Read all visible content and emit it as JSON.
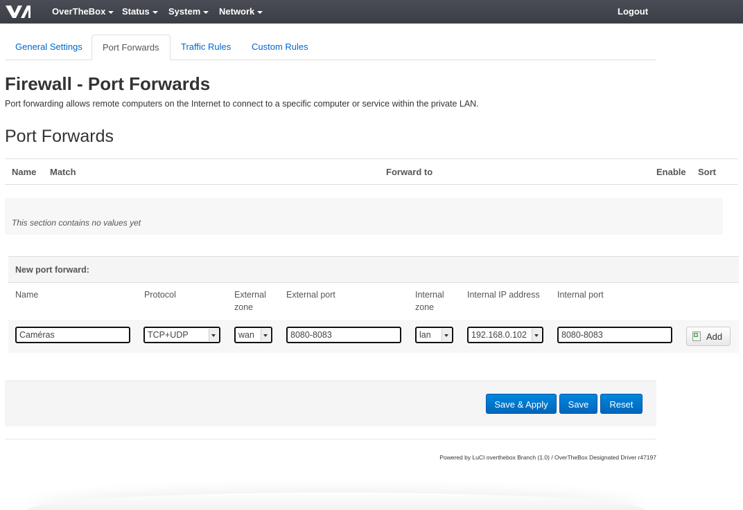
{
  "nav": {
    "brand": "OverTheBox",
    "status": "Status",
    "system": "System",
    "network": "Network",
    "logout": "Logout"
  },
  "tabs": [
    {
      "label": "General Settings",
      "active": false
    },
    {
      "label": "Port Forwards",
      "active": true
    },
    {
      "label": "Traffic Rules",
      "active": false
    },
    {
      "label": "Custom Rules",
      "active": false
    }
  ],
  "page": {
    "title": "Firewall - Port Forwards",
    "description": "Port forwarding allows remote computers on the Internet to connect to a specific computer or service within the private LAN."
  },
  "section": {
    "title": "Port Forwards",
    "headers": {
      "name": "Name",
      "match": "Match",
      "forward_to": "Forward to",
      "enable": "Enable",
      "sort": "Sort"
    },
    "empty_text": "This section contains no values yet"
  },
  "new_forward": {
    "heading": "New port forward:",
    "labels": {
      "name": "Name",
      "protocol": "Protocol",
      "external_zone": [
        "External",
        "zone"
      ],
      "external_port": "External port",
      "internal_zone": [
        "Internal",
        "zone"
      ],
      "internal_ip": "Internal IP address",
      "internal_port": "Internal port"
    },
    "values": {
      "name": "Caméras",
      "protocol": "TCP+UDP",
      "external_zone": "wan",
      "external_port": "8080-8083",
      "internal_zone": "lan",
      "internal_ip": "192.168.0.102",
      "internal_port": "8080-8083"
    },
    "add_label": "Add"
  },
  "actions": {
    "save_apply": "Save & Apply",
    "save": "Save",
    "reset": "Reset"
  },
  "footer": "Powered by LuCI overthebox Branch (1.0) / OverTheBox Designated Driver r47197",
  "colors": {
    "navbar": "#3f4249",
    "link": "#0066cc",
    "primary_button": "#0077cc"
  }
}
